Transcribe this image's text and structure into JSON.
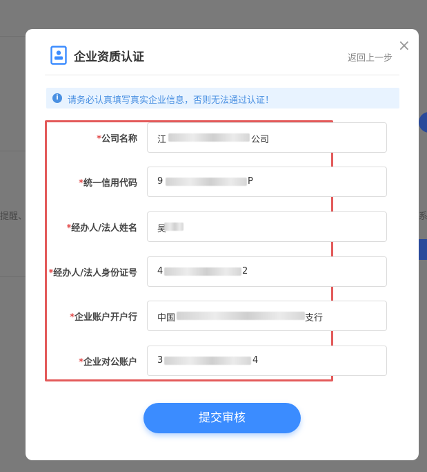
{
  "background_page": {
    "fragment_left": "提醒、索",
    "fragment_right": "系"
  },
  "modal": {
    "title": "企业资质认证",
    "back_link": "返回上一步",
    "close_label": "×",
    "notice": "请务必认真填写真实企业信息，否则无法通过认证！",
    "required_mark": "*",
    "fields": [
      {
        "label": "公司名称",
        "value_prefix": "江",
        "value_suffix": "公司"
      },
      {
        "label": "统一信用代码",
        "value_prefix": "9",
        "value_suffix": "P"
      },
      {
        "label": "经办人/法人姓名",
        "value_prefix": "吴",
        "value_suffix": ""
      },
      {
        "label": "经办人/法人身份证号",
        "value_prefix": "4",
        "value_suffix": "2"
      },
      {
        "label": "企业账户开户行",
        "value_prefix": "中国",
        "value_suffix": "支行"
      },
      {
        "label": "企业对公账户",
        "value_prefix": "3",
        "value_suffix": "4"
      }
    ],
    "submit_label": "提交审核"
  },
  "colors": {
    "accent": "#3b8cff",
    "required": "#e24848",
    "highlight_border": "#e35a5a",
    "notice_bg": "#e8f3ff"
  }
}
